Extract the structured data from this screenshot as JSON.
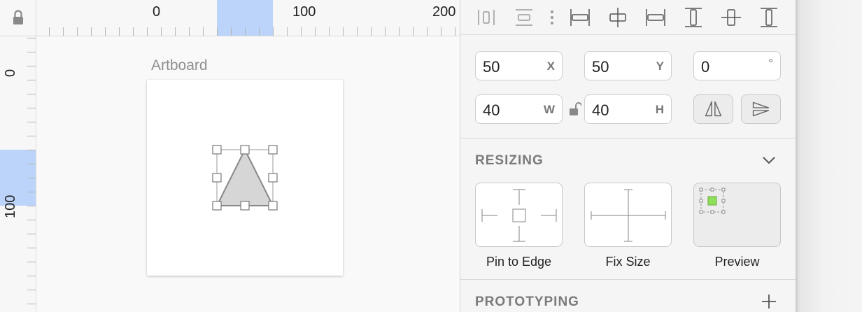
{
  "rulers": {
    "horizontal_labels": [
      "0",
      "100",
      "200"
    ],
    "vertical_labels": [
      "0",
      "100"
    ]
  },
  "canvas": {
    "artboard_label": "Artboard"
  },
  "inspector": {
    "align_icons": [
      "distribute-horizontal-icon",
      "distribute-vertical-icon",
      "more-options-icon",
      "align-left-icon",
      "align-horizontal-center-icon",
      "align-right-icon",
      "align-top-icon",
      "align-vertical-center-icon",
      "align-bottom-icon"
    ],
    "position": {
      "x": {
        "value": "50",
        "unit": "X"
      },
      "y": {
        "value": "50",
        "unit": "Y"
      },
      "rotation": {
        "value": "0",
        "unit": "°"
      }
    },
    "size": {
      "w": {
        "value": "40",
        "unit": "W"
      },
      "h": {
        "value": "40",
        "unit": "H"
      }
    },
    "resizing": {
      "title": "RESIZING",
      "cards": [
        {
          "label": "Pin to Edge"
        },
        {
          "label": "Fix Size"
        },
        {
          "label": "Preview"
        }
      ]
    },
    "prototyping": {
      "title": "PROTOTYPING"
    }
  },
  "colors": {
    "ruler_highlight": "#bcd4fa",
    "preview_fill": "#8ee05a",
    "shape_fill": "#d6d6d6"
  }
}
